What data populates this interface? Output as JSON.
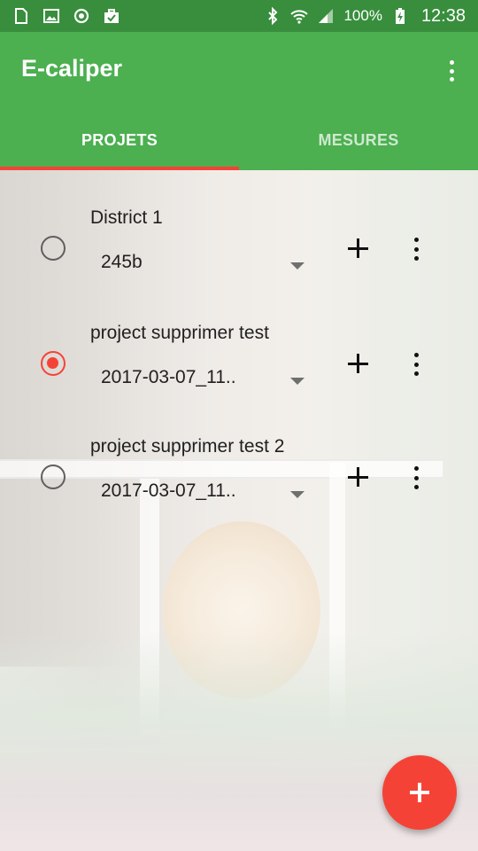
{
  "status_bar": {
    "icons_left": [
      "sim-card-icon",
      "image-icon",
      "sync-icon",
      "briefcase-check-icon"
    ],
    "icons_right": [
      "bluetooth-icon",
      "wifi-icon",
      "signal-icon",
      "battery-charging-icon"
    ],
    "battery": "100%",
    "time": "12:38"
  },
  "app_bar": {
    "title": "E-caliper",
    "menu_icon": "more-vert-icon"
  },
  "tabs": [
    {
      "label": "PROJETS",
      "active": true
    },
    {
      "label": "MESURES",
      "active": false
    }
  ],
  "projects": [
    {
      "name": "District 1",
      "selection": "245b",
      "selected": false
    },
    {
      "name": "project supprimer test",
      "selection": "2017-03-07_11..",
      "selected": true
    },
    {
      "name": "project supprimer test 2",
      "selection": "2017-03-07_11..",
      "selected": false
    }
  ],
  "fab": {
    "icon": "add-icon"
  },
  "colors": {
    "status_bar": "#388e3c",
    "primary": "#4caf50",
    "accent": "#f44336"
  }
}
